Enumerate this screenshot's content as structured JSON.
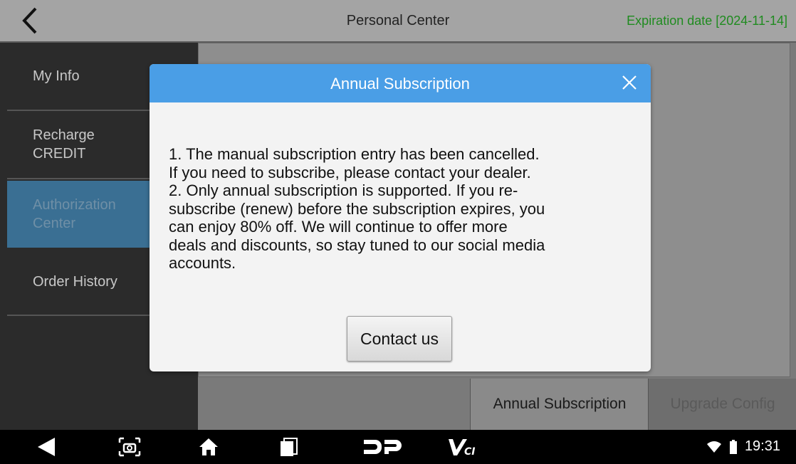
{
  "header": {
    "title": "Personal Center",
    "expiration": "Expiration date [2024-11-14]"
  },
  "sidebar": {
    "items": [
      {
        "label": "My Info",
        "active": false
      },
      {
        "label": "Recharge\nCREDIT",
        "active": false
      },
      {
        "label": "Authorization\nCenter",
        "active": true
      },
      {
        "label": "Order History",
        "active": false
      }
    ]
  },
  "tabs": {
    "annual": "Annual Subscription",
    "upgrade": "Upgrade Config"
  },
  "modal": {
    "title": "Annual Subscription",
    "lines": [
      "1. The manual subscription entry has been cancelled.",
      "If you need to subscribe, please contact your dealer.",
      "2. Only annual subscription is supported. If you re-",
      "subscribe (renew) before the subscription expires, you",
      "can enjoy 80% off. We will continue to offer more",
      "deals and discounts, so stay tuned to our social media",
      "accounts."
    ],
    "button": "Contact us"
  },
  "navbar": {
    "icons": [
      "back-triangle-icon",
      "screenshot-icon",
      "home-icon",
      "recents-icon",
      "dp-logo-icon",
      "vci-logo-icon"
    ],
    "time": "19:31"
  },
  "colors": {
    "header_blue": "#4a9ee6",
    "expiry_green": "#1f8b1f",
    "active_sidebar": "#3a6f93"
  }
}
